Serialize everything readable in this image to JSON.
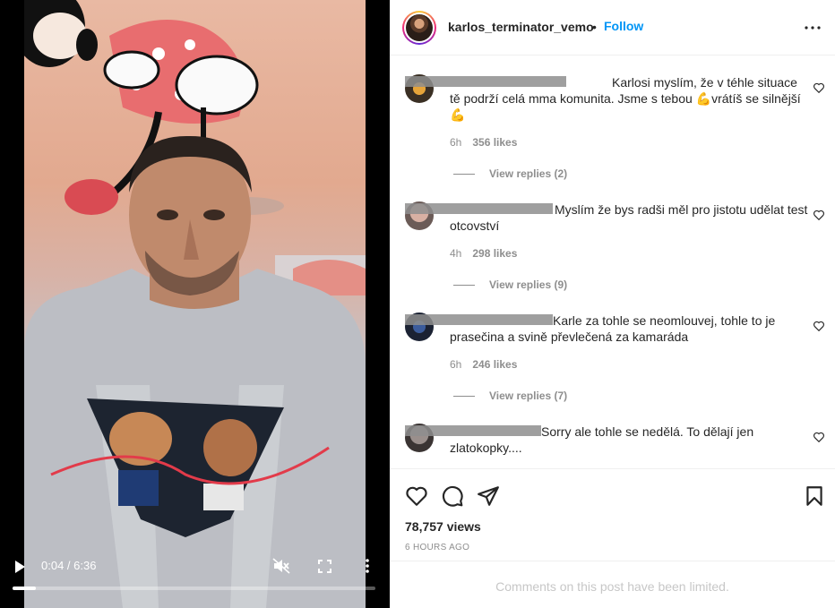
{
  "video": {
    "time_display": "0:04 / 6:36",
    "progress_fraction": 0.064,
    "icons": {
      "play": "play-icon",
      "mute": "muted-speaker-icon",
      "fullscreen": "fullscreen-icon",
      "more": "vertical-dots-icon"
    }
  },
  "post": {
    "username": "karlos_terminator_vemo",
    "separator": "•",
    "follow_label": "Follow",
    "more_icon": "horizontal-dots-icon",
    "views": "78,757 views",
    "time_ago": "6 HOURS AGO",
    "limited_notice": "Comments on this post have been limited."
  },
  "comments": [
    {
      "text": "Karlosi myslím, že v téhle situace tě podrží celá mma komunita. Jsme s tebou 💪vrátíš se silnější 💪",
      "time": "6h",
      "likes": "356 likes",
      "replies": "View replies (2)"
    },
    {
      "text": "Myslím že bys radši měl pro jistotu udělat test otcovství",
      "time": "4h",
      "likes": "298 likes",
      "replies": "View replies (9)"
    },
    {
      "text": "Karle za tohle se neomlouvej, tohle to je prasečina a svině převlečená za kamaráda",
      "time": "6h",
      "likes": "246 likes",
      "replies": "View replies (7)"
    },
    {
      "text": "Sorry ale tohle se nedělá. To dělají jen zlatokopky....",
      "time": "",
      "likes": "",
      "replies": ""
    }
  ],
  "colors": {
    "link": "#0095f6",
    "text": "#262626",
    "muted": "#8e8e8e"
  }
}
